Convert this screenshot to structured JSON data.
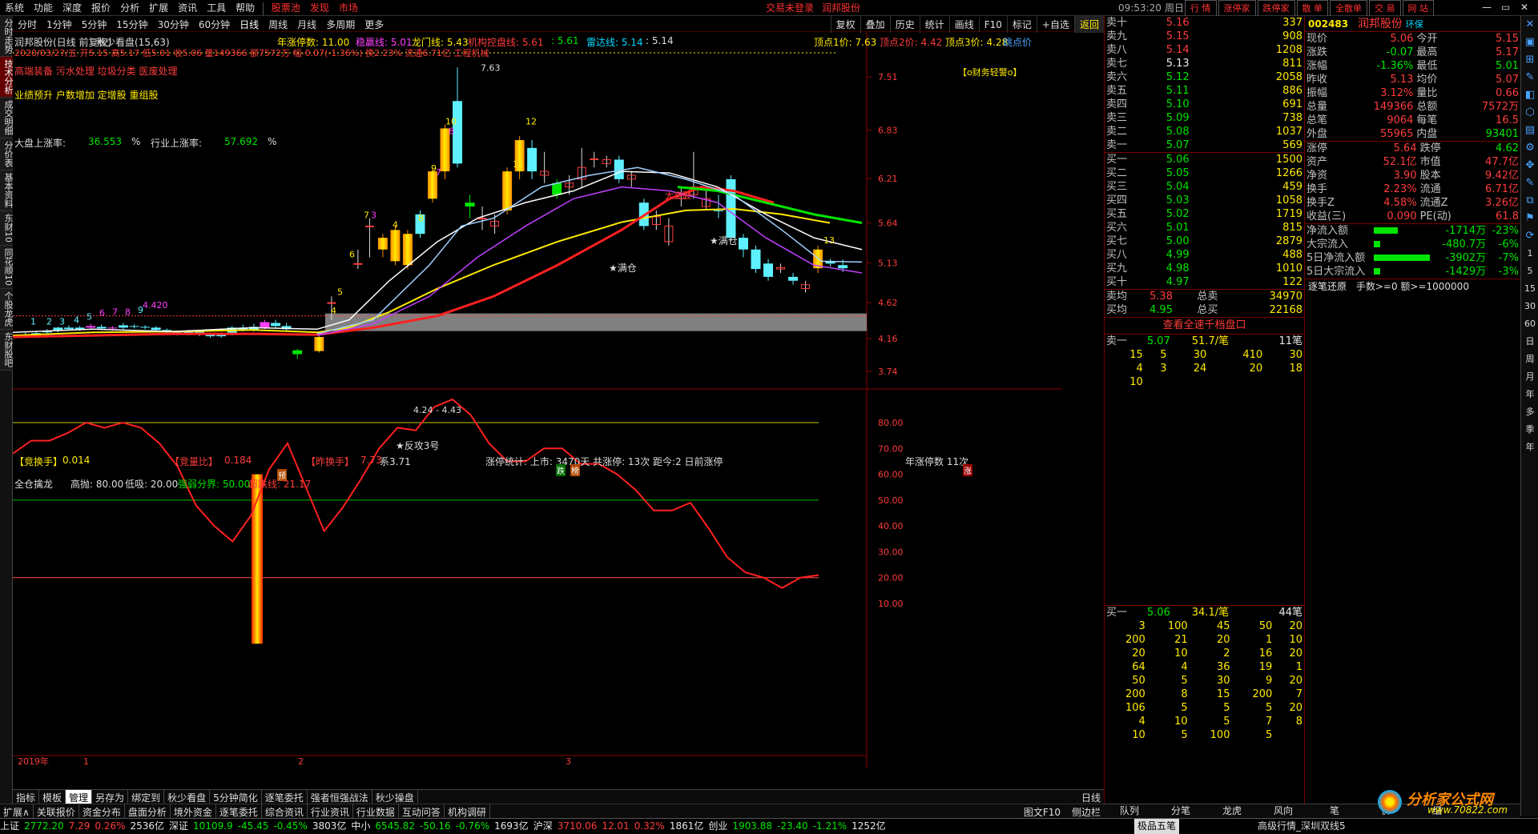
{
  "menu": {
    "items": [
      "系统",
      "功能",
      "深度",
      "报价",
      "分析",
      "扩展",
      "资讯",
      "工具",
      "帮助"
    ],
    "red_items": [
      "股票池",
      "发现",
      "市场"
    ],
    "login_notice": "交易未登录",
    "stock_name": "润邦股份",
    "time": "09:53:20",
    "weekday": "周日",
    "right_buttons": [
      "行 情",
      "涨停家",
      "跌停家",
      "散 单",
      "全散单",
      "交 易",
      "网 站"
    ]
  },
  "left_tabs": [
    "分时走势",
    "技术分析",
    "成交明细",
    "分价表",
    "基本资料",
    "东财10",
    "同花顺10",
    "个股龙虎",
    "东财股吧"
  ],
  "toolbar": {
    "periods": [
      "分时",
      "1分钟",
      "5分钟",
      "15分钟",
      "30分钟",
      "60分钟",
      "日线",
      "周线",
      "月线",
      "多周期",
      "更多"
    ],
    "active": "日线",
    "right": [
      "复权",
      "叠加",
      "历史",
      "统计",
      "画线",
      "F10",
      "标记",
      "+自选",
      "返回"
    ]
  },
  "chart_info": {
    "title": "润邦股份(日线 前复权)",
    "indicator": "秋少看盘(15,63)",
    "nian_zt": "年涨停数: 11.00",
    "wen_xian": "稳赢线: 5.01",
    "long_men": "龙门线: 5.43",
    "jigou": "机构控盘线: 5.61",
    "v561": ": 5.61",
    "leida": "雷达线: 5.14",
    "v514": ": 5.14",
    "ding1": "顶点1价: 7.63",
    "ding2": "顶点2价: 4.42",
    "ding3": "顶点3价: 4.28",
    "tiaodian": "跳点价",
    "ohlc": "2020/03/27/五 开5.15 高5.17 低5.01 收5.06 量149366 额7572万 幅-0.07(-1.36%) 换2.23% 流通6.71亿 工程机械",
    "concepts1": "高端装备 污水处理 垃圾分类 医废处理",
    "concepts2": "业绩预升 户数增加 定增股 重组股",
    "dapan": "大盘上涨率:",
    "dapan_val": "36.553",
    "hangye": "行业上涨率:",
    "hangye_val": "57.692",
    "pct": "%",
    "caiwu": "【o财务轻警o】",
    "jinghuan": "【竞换手】",
    "jinghuan_val": "0.014",
    "jingliang": "【竞量比】",
    "jingliang_val": "0.184",
    "zuohuan": "【昨换手】",
    "zuohuan_val": "7.73",
    "xi": "系3.71",
    "ztstats": "涨停统计: 上市: 3470天   共涨停: 13次   距今:2 日前涨停",
    "nian_zt2": "年涨停数  11次",
    "fangong": "★反攻3号",
    "mancang": "★满仓",
    "mancang2": "★满仓",
    "dalu": "大突破",
    "dalu2": "涨",
    "yu": "预",
    "die": "跌",
    "bang": "榜",
    "zhang": "涨",
    "zone_labels": "4.24 - 4.43",
    "yf": "满仓"
  },
  "chart_data": {
    "type": "candlestick",
    "price_axis": [
      7.51,
      6.83,
      6.21,
      5.64,
      5.13,
      4.62,
      4.16,
      3.74
    ],
    "osc_axis": [
      80.0,
      70.0,
      60.0,
      50.0,
      40.0,
      30.0,
      20.0,
      10.0
    ],
    "x_labels": [
      "2019年",
      "1",
      "2",
      "3"
    ],
    "osc_title": "全仓擒龙",
    "osc_high": "高抛: 80.00",
    "osc_low": "低吸: 20.00",
    "osc_mid": "强弱分界: 50.00",
    "osc_val": "超跌线: 21.17",
    "peak_label": "7.63",
    "label_4420": "4.420",
    "osc_series": [
      68,
      73,
      73,
      76,
      80,
      78,
      80,
      78,
      72,
      63,
      48,
      40,
      34,
      44,
      62,
      72,
      55,
      38,
      47,
      58,
      70,
      78,
      77,
      86,
      89,
      83,
      72,
      65,
      65,
      70,
      70,
      64,
      64,
      60,
      54,
      46,
      46,
      49,
      39,
      28,
      22,
      20,
      16,
      20,
      21
    ]
  },
  "quote": {
    "sell": [
      {
        "l": "卖十",
        "p": "5.16",
        "v": "337"
      },
      {
        "l": "卖九",
        "p": "5.15",
        "v": "908"
      },
      {
        "l": "卖八",
        "p": "5.14",
        "v": "1208"
      },
      {
        "l": "卖七",
        "p": "5.13",
        "v": "811"
      },
      {
        "l": "卖六",
        "p": "5.12",
        "v": "2058"
      },
      {
        "l": "卖五",
        "p": "5.11",
        "v": "886"
      },
      {
        "l": "卖四",
        "p": "5.10",
        "v": "691"
      },
      {
        "l": "卖三",
        "p": "5.09",
        "v": "738"
      },
      {
        "l": "卖二",
        "p": "5.08",
        "v": "1037"
      },
      {
        "l": "卖一",
        "p": "5.07",
        "v": "569"
      }
    ],
    "buy": [
      {
        "l": "买一",
        "p": "5.06",
        "v": "1500"
      },
      {
        "l": "买二",
        "p": "5.05",
        "v": "1266"
      },
      {
        "l": "买三",
        "p": "5.04",
        "v": "459"
      },
      {
        "l": "买四",
        "p": "5.03",
        "v": "1058"
      },
      {
        "l": "买五",
        "p": "5.02",
        "v": "1719"
      },
      {
        "l": "买六",
        "p": "5.01",
        "v": "815"
      },
      {
        "l": "买七",
        "p": "5.00",
        "v": "2879"
      },
      {
        "l": "买八",
        "p": "4.99",
        "v": "488"
      },
      {
        "l": "买九",
        "p": "4.98",
        "v": "1010"
      },
      {
        "l": "买十",
        "p": "4.97",
        "v": "122"
      }
    ],
    "avg_sell_l": "卖均",
    "avg_sell_p": "5.38",
    "avg_sell_t": "总卖",
    "avg_sell_v": "34970",
    "avg_buy_l": "买均",
    "avg_buy_p": "4.95",
    "avg_buy_t": "总买",
    "avg_buy_v": "22168",
    "link": "查看全速千档盘口",
    "s1_l": "卖一",
    "s1_p": "5.07",
    "s1_per": "51.7/笔",
    "s1_cnt": "11笔",
    "s1_rows": [
      [
        "15",
        "5",
        "30",
        "410",
        "30"
      ],
      [
        "4",
        "3",
        "24",
        "20",
        "18"
      ],
      [
        "10",
        "",
        "",
        "",
        ""
      ]
    ],
    "b1_l": "买一",
    "b1_p": "5.06",
    "b1_per": "34.1/笔",
    "b1_cnt": "44笔",
    "b1_rows": [
      [
        "3",
        "100",
        "45",
        "50",
        "20"
      ],
      [
        "200",
        "21",
        "20",
        "1",
        "10"
      ],
      [
        "20",
        "10",
        "2",
        "16",
        "20"
      ],
      [
        "64",
        "4",
        "36",
        "19",
        "1"
      ],
      [
        "50",
        "5",
        "30",
        "9",
        "20"
      ],
      [
        "200",
        "8",
        "15",
        "200",
        "7"
      ],
      [
        "106",
        "5",
        "5",
        "5",
        "20"
      ],
      [
        "4",
        "10",
        "5",
        "7",
        "8"
      ],
      [
        "10",
        "5",
        "100",
        "5",
        ""
      ]
    ]
  },
  "info": {
    "code": "002483",
    "name": "润邦股份",
    "tag": "环保",
    "rows": [
      [
        "现价",
        "5.06",
        "今开",
        "5.15"
      ],
      [
        "涨跌",
        "-0.07",
        "最高",
        "5.17"
      ],
      [
        "涨幅",
        "-1.36%",
        "最低",
        "5.01"
      ],
      [
        "昨收",
        "5.13",
        "均价",
        "5.07"
      ],
      [
        "振幅",
        "3.12%",
        "量比",
        "0.66"
      ],
      [
        "总量",
        "149366",
        "总额",
        "7572万"
      ],
      [
        "总笔",
        "9064",
        "每笔",
        "16.5"
      ],
      [
        "外盘",
        "55965",
        "内盘",
        "93401"
      ]
    ],
    "rows2": [
      [
        "涨停",
        "5.64",
        "跌停",
        "4.62"
      ],
      [
        "资产",
        "52.1亿",
        "市值",
        "47.7亿"
      ],
      [
        "净资",
        "3.90",
        "股本",
        "9.42亿"
      ],
      [
        "换手",
        "2.23%",
        "流通",
        "6.71亿"
      ],
      [
        "换手Z",
        "4.58%",
        "流通Z",
        "3.26亿"
      ],
      [
        "收益(三)",
        "0.090",
        "PE(动)",
        "61.8"
      ]
    ],
    "flows": [
      {
        "l": "净流入额",
        "v": "-1714万",
        "p": "-23%"
      },
      {
        "l": "大宗流入",
        "v": "-480.7万",
        "p": "-6%"
      },
      {
        "l": "5日净流入额",
        "v": "-3902万",
        "p": "-7%"
      },
      {
        "l": "5日大宗流入",
        "v": "-1429万",
        "p": "-3%"
      }
    ],
    "tick_title": "逐笔还原",
    "tick_filter": "手数>=0 额>=1000000"
  },
  "bottom": {
    "tabs1": [
      "指标",
      "模板",
      "管理",
      "另存为",
      "绑定到",
      "秋少看盘",
      "5分钟简化",
      "逐笔委托",
      "强者恒强战法",
      "秋少操盘"
    ],
    "tabs1_active": "管理",
    "daily": "日线",
    "tabs2": [
      "扩展∧",
      "关联报价",
      "资金分布",
      "盘面分析",
      "境外资金",
      "逐笔委托",
      "综合资讯",
      "行业资讯",
      "行业数据",
      "互动问答",
      "机构调研"
    ],
    "right_label": "图文F10",
    "right_label2": "侧边栏",
    "panel_tabs": [
      "队列",
      "分笔",
      "龙虎",
      "风向",
      "笔",
      "价",
      "细"
    ]
  },
  "status": [
    {
      "t": "上证",
      "c": "wh"
    },
    {
      "t": "2772.20",
      "c": "dn"
    },
    {
      "t": "7.29",
      "c": "up"
    },
    {
      "t": "0.26%",
      "c": "up"
    },
    {
      "t": "2536亿",
      "c": "wh"
    },
    {
      "t": "深证",
      "c": "wh"
    },
    {
      "t": "10109.9",
      "c": "dn"
    },
    {
      "t": "-45.45",
      "c": "dn"
    },
    {
      "t": "-0.45%",
      "c": "dn"
    },
    {
      "t": "3803亿",
      "c": "wh"
    },
    {
      "t": "中小",
      "c": "wh"
    },
    {
      "t": "6545.82",
      "c": "dn"
    },
    {
      "t": "-50.16",
      "c": "dn"
    },
    {
      "t": "-0.76%",
      "c": "dn"
    },
    {
      "t": "1693亿",
      "c": "wh"
    },
    {
      "t": "沪深",
      "c": "wh"
    },
    {
      "t": "3710.06",
      "c": "up"
    },
    {
      "t": "12.01",
      "c": "up"
    },
    {
      "t": "0.32%",
      "c": "up"
    },
    {
      "t": "1861亿",
      "c": "wh"
    },
    {
      "t": "创业",
      "c": "wh"
    },
    {
      "t": "1903.88",
      "c": "dn"
    },
    {
      "t": "-23.40",
      "c": "dn"
    },
    {
      "t": "-1.21%",
      "c": "dn"
    },
    {
      "t": "1252亿",
      "c": "wh"
    }
  ],
  "status_tail": "高级行情_深圳双线5",
  "status_mid": "极品五笔",
  "logo_main": "分析家公式网",
  "logo_url": "www.70822.com",
  "right_strip": [
    "日",
    "周",
    "月",
    "年",
    "多",
    "季",
    "年"
  ],
  "right_strip_nums": [
    "1",
    "5",
    "15",
    "30",
    "60"
  ],
  "colors": {
    "up": "#ff3c3c",
    "down": "#00e600",
    "cyan": "#00d8ff",
    "yellow": "#ffea00",
    "bg": "#000000"
  }
}
